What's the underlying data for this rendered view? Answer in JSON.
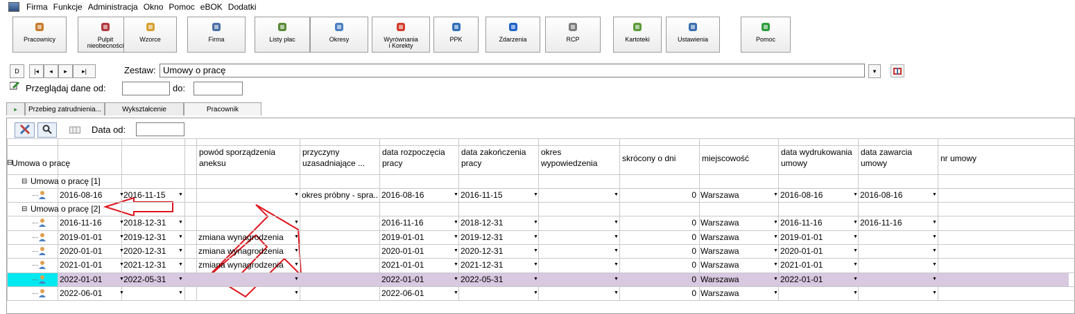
{
  "menu": [
    "Firma",
    "Funkcje",
    "Administracja",
    "Okno",
    "Pomoc",
    "eBOK",
    "Dodatki"
  ],
  "toolbar": [
    {
      "label": "Pracownicy",
      "icon": "people-icon",
      "color": "#c77a2a"
    },
    {
      "label": "Pulpit\nnieobecności",
      "icon": "calendar-icon",
      "color": "#b0383e"
    },
    {
      "label": "Wzorce",
      "icon": "templates-icon",
      "color": "#d8a030"
    },
    {
      "label": "Firma",
      "icon": "company-icon",
      "color": "#4a6fa5"
    },
    {
      "label": "Listy płac",
      "icon": "payroll-icon",
      "color": "#5b8a3a"
    },
    {
      "label": "Okresy",
      "icon": "periods-icon",
      "color": "#4a80c0"
    },
    {
      "label": "Wyrównania\ni Korekty",
      "icon": "correction-icon",
      "color": "#d23b2b"
    },
    {
      "label": "PPK",
      "icon": "chart-icon",
      "color": "#2f6fb8"
    },
    {
      "label": "Zdarzenia",
      "icon": "info-icon",
      "color": "#1e63c7"
    },
    {
      "label": "RCP",
      "icon": "clock-icon",
      "color": "#7d7d7d"
    },
    {
      "label": "Kartoteki",
      "icon": "binders-icon",
      "color": "#5a9a3a"
    },
    {
      "label": "Ustawienia",
      "icon": "tools-icon",
      "color": "#3a6fb0"
    },
    {
      "label": "Pomoc",
      "icon": "help-icon",
      "color": "#2c9c3c"
    }
  ],
  "nav": {
    "buttons": [
      "D",
      "|◂",
      "◂",
      "▸",
      "▸|"
    ],
    "zestaw_label": "Zestaw:",
    "zestaw_value": "Umowy o pracę"
  },
  "filter": {
    "label": "Przeglądaj dane od:",
    "from": "",
    "to_label": "do:",
    "to": ""
  },
  "tabs": [
    "Przebieg zatrudnienia...",
    "Wykształcenie",
    "Pracownik"
  ],
  "grid_toolbar": {
    "data_od_label": "Data od:",
    "data_od_value": ""
  },
  "grid": {
    "tree_header": "Umowa o pracę",
    "columns": [
      "powód sporządzenia\naneksu",
      "przyczyny\nuzasadniające ...",
      "data rozpoczęcia\npracy",
      "data zakończenia\npracy",
      "okres\nwypowiedzenia",
      "skrócony o dni",
      "miejscowość",
      "data wydrukowania\numowy",
      "data zawarcia\numowy",
      "nr umowy"
    ],
    "groups": [
      {
        "label": "Umowa o pracę [1]",
        "rows": [
          {
            "from": "2016-08-16",
            "to": "2016-11-15",
            "powod": "",
            "przyczyny": "okres próbny - spra...",
            "start": "2016-08-16",
            "end": "2016-11-15",
            "okres": "",
            "skrocony": "0",
            "miejscowosc": "Warszawa",
            "wydruk": "2016-08-16",
            "zawarcie": "2016-08-16",
            "nr": "",
            "selected": false
          }
        ]
      },
      {
        "label": "Umowa o pracę [2]",
        "rows": [
          {
            "from": "2016-11-16",
            "to": "2018-12-31",
            "powod": "",
            "przyczyny": "",
            "start": "2016-11-16",
            "end": "2018-12-31",
            "okres": "",
            "skrocony": "0",
            "miejscowosc": "Warszawa",
            "wydruk": "2016-11-16",
            "zawarcie": "2016-11-16",
            "nr": "",
            "selected": false
          },
          {
            "from": "2019-01-01",
            "to": "2019-12-31",
            "powod": "zmiana wynagrodzenia",
            "przyczyny": "",
            "start": "2019-01-01",
            "end": "2019-12-31",
            "okres": "",
            "skrocony": "0",
            "miejscowosc": "Warszawa",
            "wydruk": "2019-01-01",
            "zawarcie": "",
            "nr": "",
            "selected": false
          },
          {
            "from": "2020-01-01",
            "to": "2020-12-31",
            "powod": "zmiana wynagrodzenia",
            "przyczyny": "",
            "start": "2020-01-01",
            "end": "2020-12-31",
            "okres": "",
            "skrocony": "0",
            "miejscowosc": "Warszawa",
            "wydruk": "2020-01-01",
            "zawarcie": "",
            "nr": "",
            "selected": false
          },
          {
            "from": "2021-01-01",
            "to": "2021-12-31",
            "powod": "zmiana wynagrodzenia",
            "przyczyny": "",
            "start": "2021-01-01",
            "end": "2021-12-31",
            "okres": "",
            "skrocony": "0",
            "miejscowosc": "Warszawa",
            "wydruk": "2021-01-01",
            "zawarcie": "",
            "nr": "",
            "selected": false
          },
          {
            "from": "2022-01-01",
            "to": "2022-05-31",
            "powod": "",
            "przyczyny": "",
            "start": "2022-01-01",
            "end": "2022-05-31",
            "okres": "",
            "skrocony": "0",
            "miejscowosc": "Warszawa",
            "wydruk": "2022-01-01",
            "zawarcie": "",
            "nr": "",
            "selected": true
          },
          {
            "from": "2022-06-01",
            "to": "",
            "powod": "",
            "przyczyny": "",
            "start": "2022-06-01",
            "end": "",
            "okres": "",
            "skrocony": "0",
            "miejscowosc": "Warszawa",
            "wydruk": "",
            "zawarcie": "",
            "nr": "",
            "selected": false
          }
        ]
      }
    ]
  },
  "colors": {
    "selected_row": "#d8c8e0",
    "selected_indicator": "#00e8f0",
    "annotation_arrow": "#e0141c"
  }
}
